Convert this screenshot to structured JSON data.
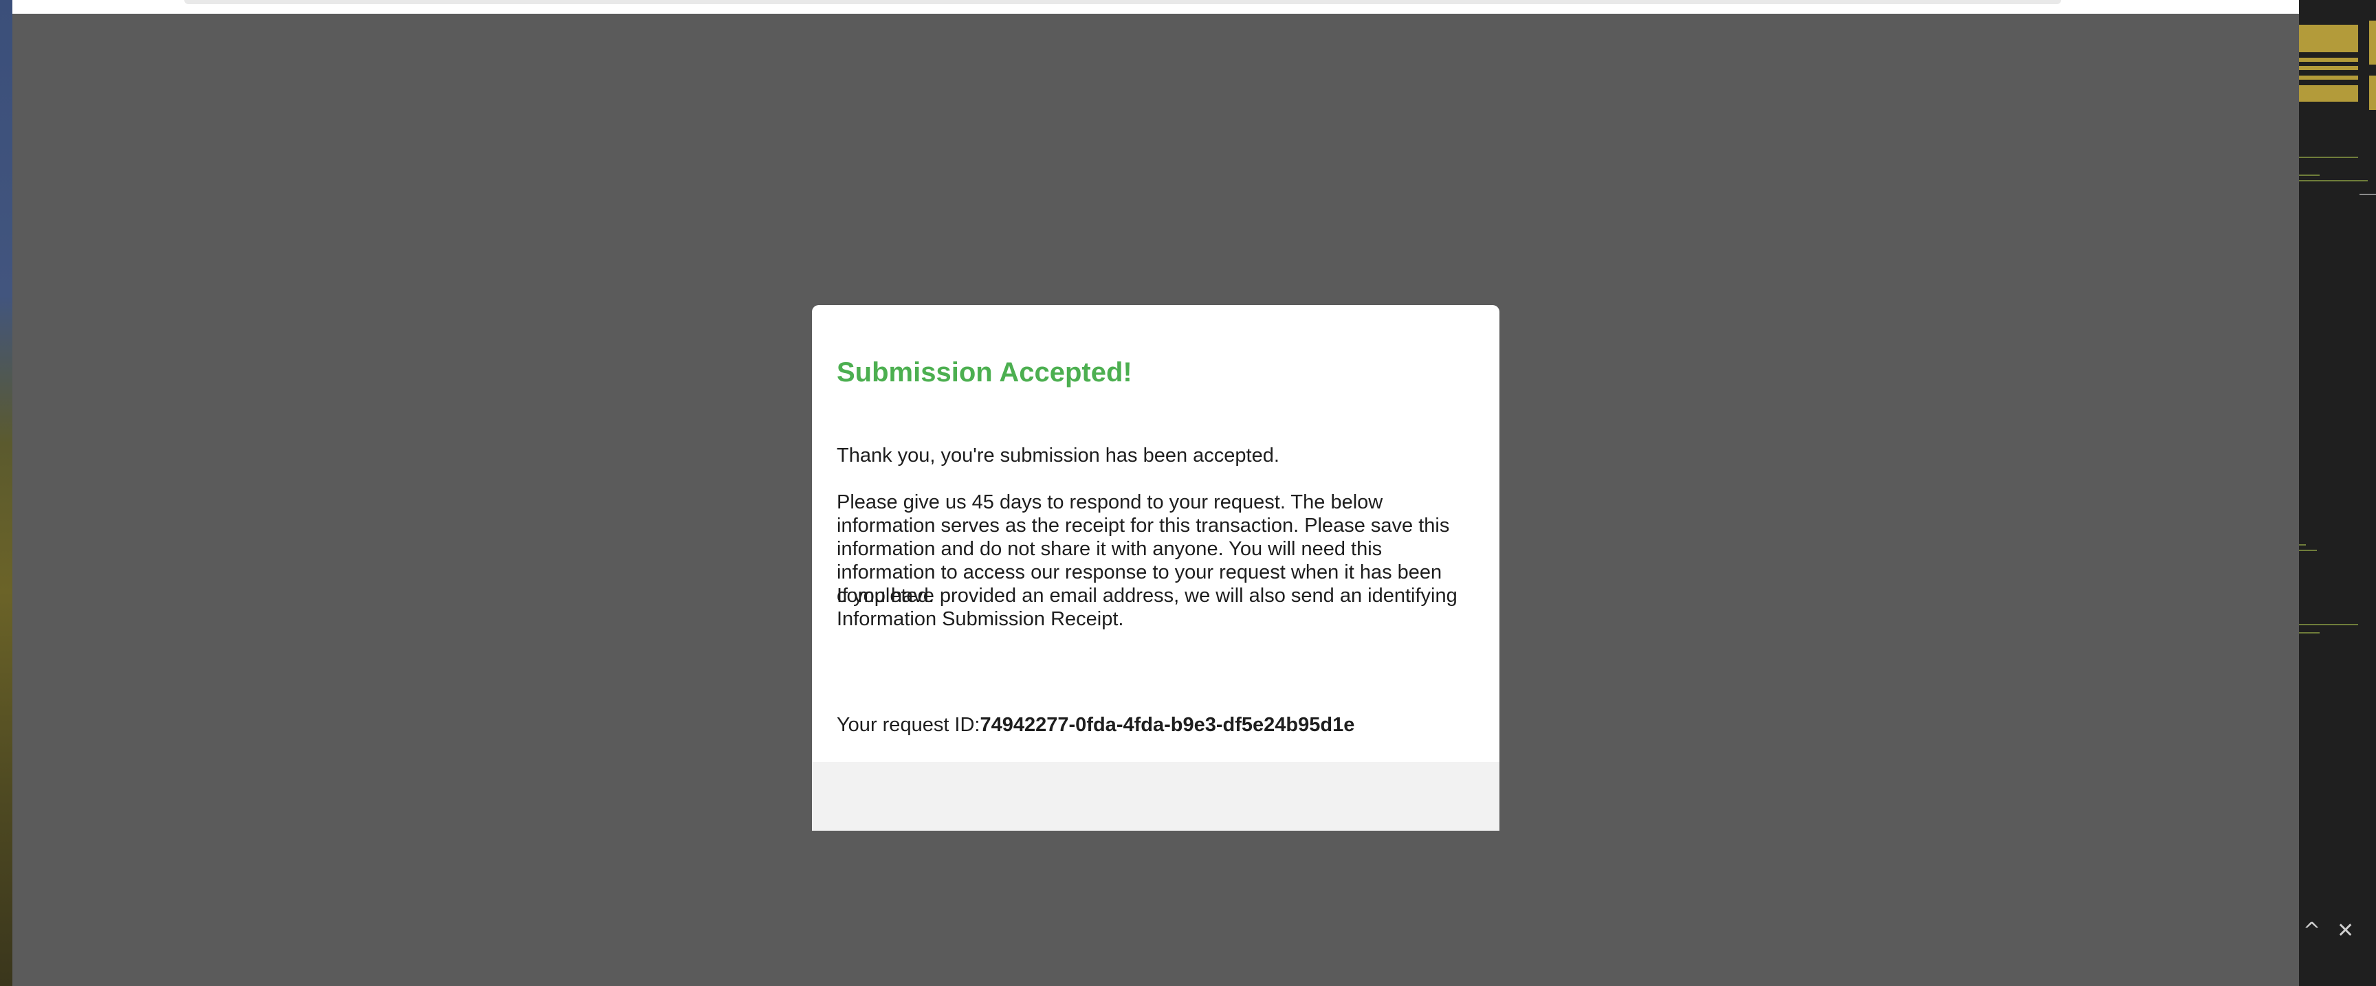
{
  "modal": {
    "title": "Submission Accepted!",
    "paragraph_1": "Thank you, you're submission has been accepted.",
    "paragraph_2": "Please give us 45 days to respond to your request. The below information serves as the receipt for this transaction. Please save this information and do not share it with anyone. You will need this information to access our response to your request when it has been completed.",
    "paragraph_3": "If you have provided an email address, we will also send an identifying Information Submission Receipt.",
    "request_id_label": "Your request ID:",
    "request_id_value": "74942277-0fda-4fda-b9e3-df5e24b95d1e"
  },
  "side_panel": {
    "collapse_glyph": "^",
    "close_glyph": "✕",
    "icons": [
      "chevron-up-icon",
      "close-icon"
    ]
  },
  "colors": {
    "title_green": "#4caf50",
    "overlay_gray": "#5b5b5b",
    "footer_gray": "#f2f2f2"
  }
}
